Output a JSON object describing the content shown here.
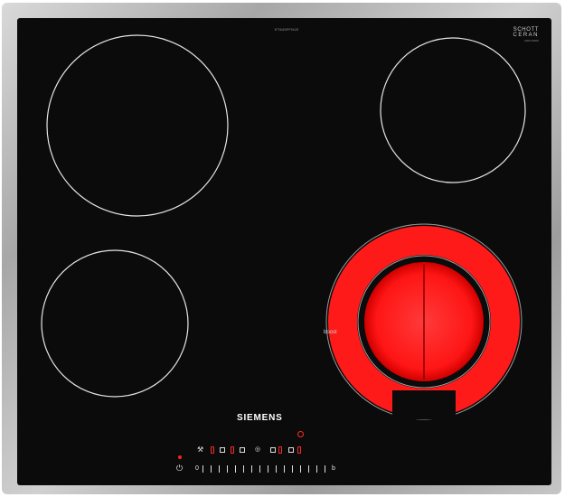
{
  "model_code": "ET645FFN1E",
  "schott": {
    "line1": "SCHOTT",
    "line2": "CERAN",
    "line3": "0000 00000"
  },
  "brand": "SIEMENS",
  "boost_label": "boost",
  "controls": {
    "power_symbol": "⏻",
    "slider_zero": "0",
    "slider_end": "b"
  },
  "colors": {
    "glass": "#0b0b0b",
    "zone_outline": "#e6e6e6",
    "heating": "#ff1a1a",
    "frame": "#b5b5b5",
    "indicator": "#ff2a2a"
  },
  "zones": [
    {
      "name": "rear-left",
      "state": "off"
    },
    {
      "name": "rear-right",
      "state": "off"
    },
    {
      "name": "front-left",
      "state": "off"
    },
    {
      "name": "front-right-dual",
      "state": "on"
    }
  ]
}
